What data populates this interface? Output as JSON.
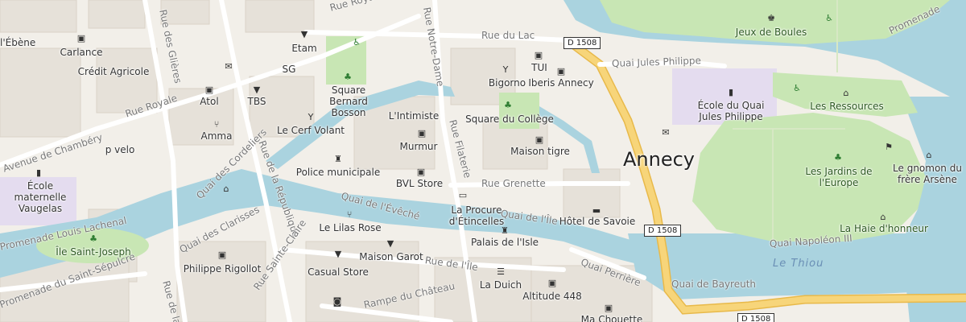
{
  "map": {
    "city_label": "Annecy",
    "water_label": "Le Thiou",
    "route_shields": [
      "D 1508",
      "D 1508",
      "D 1508"
    ],
    "colors": {
      "land": "#f2efe9",
      "water": "#aad3df",
      "park": "#c8e6b4",
      "school": "#e4dcef",
      "main_road": "#f7d57a",
      "building": "#e6e1d9"
    },
    "streets": [
      "Rue Royale",
      "Rue Royale",
      "Rue Notre-Dame",
      "Rue du Lac",
      "Quai Jules Philippe",
      "Rue Filaterie",
      "Rue Grenette",
      "Quai de l'Évêché",
      "Quai de l'Île",
      "Quai des Clarisses",
      "Rue de la République",
      "Quai des Cordeliers",
      "Avenue de Chambéry",
      "Rue des Glières",
      "Promenade Louis Lachenal",
      "Rue Sainte-Claire",
      "Rue de l'Île",
      "Promenade du Saint-Sépulcre",
      "Rue de la",
      "Rampe du Château",
      "Quai Perrière",
      "Quai de Bayreuth",
      "Quai Napoléon III",
      "Promenade"
    ],
    "places": [
      {
        "label": "l'Ébène",
        "icon": "shop-icon"
      },
      {
        "label": "Carlance",
        "icon": "shopping-bag-icon"
      },
      {
        "label": "Crédit Agricole",
        "icon": "bank-icon"
      },
      {
        "label": "Etam",
        "icon": "clothes-icon"
      },
      {
        "label": "SG",
        "icon": "bank-icon"
      },
      {
        "label": "Square Bernard Bosson",
        "icon": "tree-icon"
      },
      {
        "label": "Atol",
        "icon": "shopping-bag-icon"
      },
      {
        "label": "TBS",
        "icon": "clothes-icon"
      },
      {
        "label": "Le Cerf Volant",
        "icon": "bar-icon"
      },
      {
        "label": "Amma",
        "icon": "restaurant-icon"
      },
      {
        "label": "p velo",
        "icon": "bicycle-icon"
      },
      {
        "label": "École maternelle Vaugelas",
        "icon": "school-icon"
      },
      {
        "label": "Police municipale",
        "icon": "police-icon"
      },
      {
        "label": "L'Intimiste",
        "icon": "shop-icon"
      },
      {
        "label": "Murmur",
        "icon": "shopping-bag-icon"
      },
      {
        "label": "BVL Store",
        "icon": "shopping-bag-icon"
      },
      {
        "label": "Bigorno",
        "icon": "bar-icon"
      },
      {
        "label": "TUI",
        "icon": "shopping-bag-icon"
      },
      {
        "label": "Iberis Annecy",
        "icon": "shopping-bag-icon"
      },
      {
        "label": "Square du Collège",
        "icon": "tree-icon"
      },
      {
        "label": "Maison tigre",
        "icon": "shopping-bag-icon"
      },
      {
        "label": "La Procure d'Étincelles",
        "icon": "book-icon"
      },
      {
        "label": "Le Lilas Rose",
        "icon": "restaurant-icon"
      },
      {
        "label": "Maison Garot",
        "icon": "clothes-icon"
      },
      {
        "label": "Palais de l'Isle",
        "icon": "castle-icon"
      },
      {
        "label": "Hôtel de Savoie",
        "icon": "hotel-icon"
      },
      {
        "label": "Île Saint-Joseph",
        "icon": "tree-icon"
      },
      {
        "label": "Philippe Rigollot",
        "icon": "shopping-bag-icon"
      },
      {
        "label": "Casual Store",
        "icon": "clothes-icon"
      },
      {
        "label": "La Duich",
        "icon": "cafe-icon"
      },
      {
        "label": "Altitude 448",
        "icon": "shopping-bag-icon"
      },
      {
        "label": "Ma Chouette",
        "icon": "shopping-bag-icon"
      },
      {
        "label": "Jeux de Boules",
        "icon": "sport-icon"
      },
      {
        "label": "École du Quai Jules Philippe",
        "icon": "school-icon"
      },
      {
        "label": "Les Ressources",
        "icon": "building-icon"
      },
      {
        "label": "Les Jardins de l'Europe",
        "icon": "tree-icon"
      },
      {
        "label": "Le gnomon du frère Arsène",
        "icon": "monument-icon"
      },
      {
        "label": "La Haie d'honneur",
        "icon": "monument-icon"
      }
    ]
  }
}
